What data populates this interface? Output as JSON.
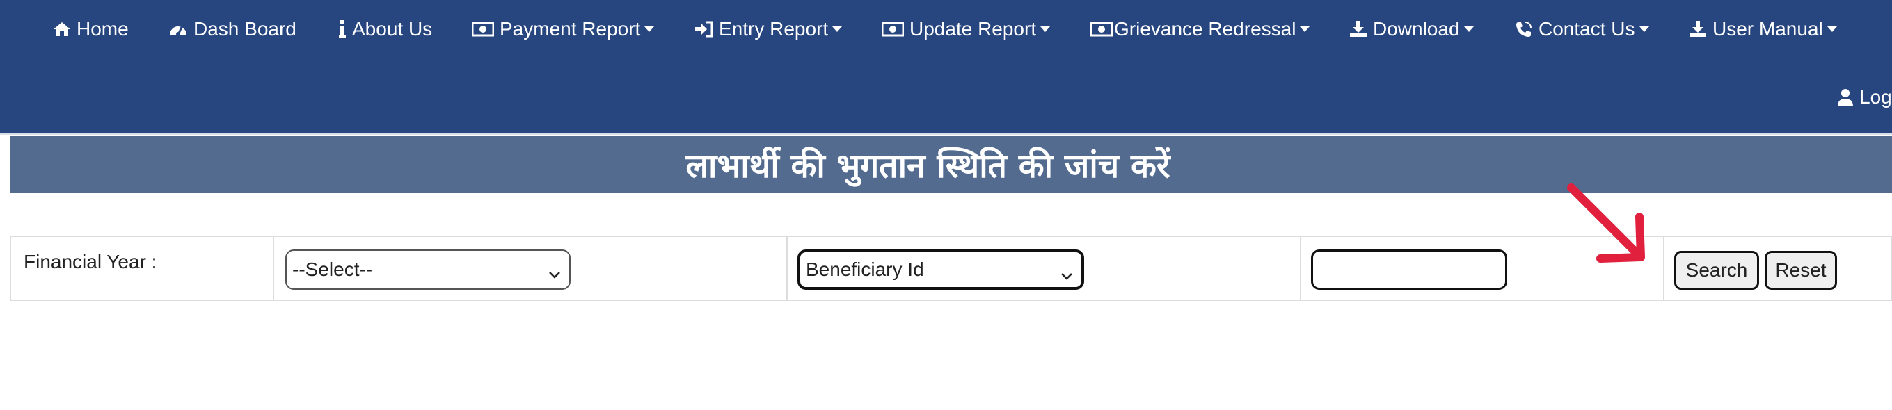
{
  "navbar": {
    "items": [
      {
        "label": "Home",
        "icon": "home-icon",
        "dropdown": false
      },
      {
        "label": "Dash Board",
        "icon": "dashboard-icon",
        "dropdown": false
      },
      {
        "label": "About Us",
        "icon": "info-icon",
        "dropdown": false
      },
      {
        "label": "Payment Report",
        "icon": "money-icon",
        "dropdown": true
      },
      {
        "label": "Entry Report",
        "icon": "sign-in-icon",
        "dropdown": true
      },
      {
        "label": "Update Report",
        "icon": "money-icon",
        "dropdown": true
      },
      {
        "label": "Grievance Redressal",
        "icon": "money-icon",
        "dropdown": true
      },
      {
        "label": "Download",
        "icon": "download-icon",
        "dropdown": true
      },
      {
        "label": "Contact Us",
        "icon": "phone-icon",
        "dropdown": true
      },
      {
        "label": "User Manual",
        "icon": "download-icon",
        "dropdown": true
      }
    ],
    "login_label": "Log"
  },
  "page": {
    "title": "लाभार्थी की भुगतान स्थिति की जांच करें"
  },
  "form": {
    "financial_year_label": "Financial Year :",
    "financial_year_selected": "--Select--",
    "search_type_selected": "Beneficiary Id",
    "search_value": "",
    "search_button": "Search",
    "reset_button": "Reset"
  },
  "colors": {
    "navbar": "#27467f",
    "title_bar": "#536b8f",
    "annotation_arrow": "#e0203c"
  }
}
